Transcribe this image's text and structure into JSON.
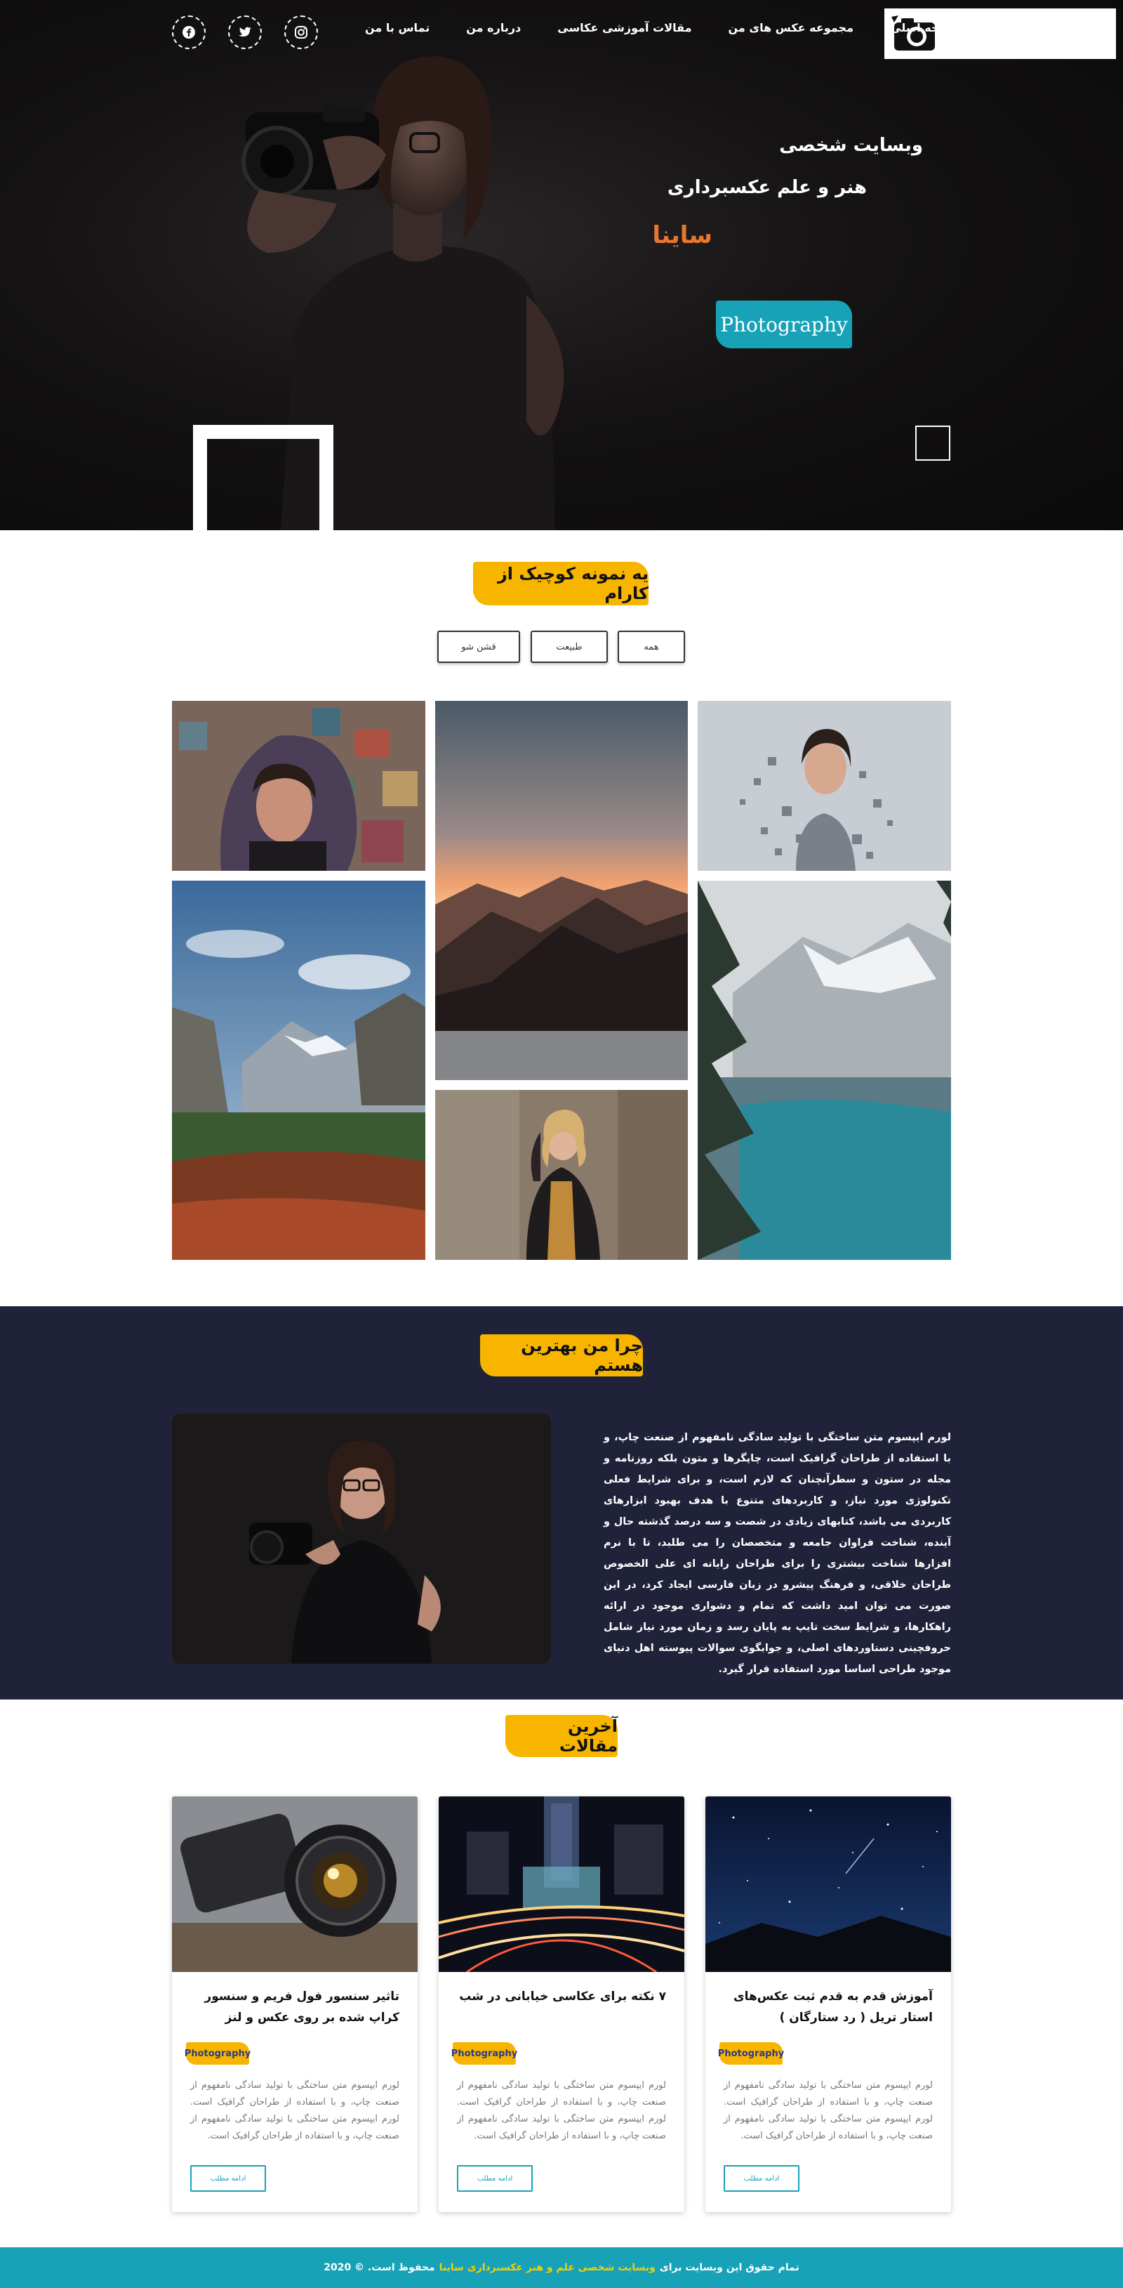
{
  "nav": {
    "items": [
      {
        "label": "صفحه اصلی"
      },
      {
        "label": "مجموعه عکس های من"
      },
      {
        "label": "مقالات آموزشی عکاسی"
      },
      {
        "label": "درباره من"
      },
      {
        "label": "تماس با من"
      }
    ],
    "socials": [
      "facebook-icon",
      "twitter-icon",
      "instagram-icon"
    ]
  },
  "hero": {
    "title": "وبسایت شخصی",
    "subtitle": "هنر و علم عکسبرداری",
    "name": "ساینا",
    "badge": "Photography"
  },
  "portfolio": {
    "heading": "یه نمونه کوچیک از کارام",
    "filters": [
      "همه",
      "طبیعت",
      "قشن شو"
    ]
  },
  "why": {
    "heading": "چرا من بهترین هستم",
    "text": "لورم ایپسوم متن ساختگی با تولید سادگی نامفهوم از صنعت چاپ، و با استفاده از طراحان گرافیک است، چاپگرها و متون بلکه روزنامه و مجله در ستون و سطرآنچنان که لازم است، و برای شرایط فعلی تکنولوژی مورد نیاز، و کاربردهای متنوع با هدف بهبود ابزارهای کاربردی می باشد، کتابهای زیادی در شصت و سه درصد گذشته حال و آینده، شناخت فراوان جامعه و متخصصان را می طلبد، تا با نرم افزارها شناخت بیشتری را برای طراحان رایانه ای علی الخصوص طراحان خلاقی، و فرهنگ پیشرو در زبان فارسی ایجاد کرد، در این صورت می توان امید داشت که تمام و دشواری موجود در ارائه راهکارها، و شرایط سخت تایپ به پایان رسد و زمان مورد نیاز شامل حروفچینی دستاوردهای اصلی، و جوابگوی سوالات پیوسته اهل دنیای موجود طراحی اساسا مورد استفاده قرار گیرد."
  },
  "articles": {
    "heading": "آخرین مقالات",
    "items": [
      {
        "title": "آموزش قدم به قدم ثبت عکس‌های استار تریل ( رد ستارگان )",
        "badge": "Photography",
        "text": "لورم ایپسوم متن ساختگی با تولید سادگی نامفهوم از صنعت چاپ، و با استفاده از طراحان گرافیک است. لورم ایپسوم متن ساختگی با تولید سادگی نامفهوم از صنعت چاپ، و با استفاده از طراحان گرافیک است.",
        "button": "ادامه مطلب"
      },
      {
        "title": "۷ نکته برای عکاسی خیابانی در شب",
        "badge": "Photography",
        "text": "لورم ایپسوم متن ساختگی با تولید سادگی نامفهوم از صنعت چاپ، و با استفاده از طراحان گرافیک است. لورم ایپسوم متن ساختگی با تولید سادگی نامفهوم از صنعت چاپ، و با استفاده از طراحان گرافیک است.",
        "button": "ادامه مطلب"
      },
      {
        "title": "تاثیر سنسور فول فریم و سنسور کراپ شده بر روی عکس و لنز",
        "badge": "Photography",
        "text": "لورم ایپسوم متن ساختگی با تولید سادگی نامفهوم از صنعت چاپ، و با استفاده از طراحان گرافیک است. لورم ایپسوم متن ساختگی با تولید سادگی نامفهوم از صنعت چاپ، و با استفاده از طراحان گرافیک است.",
        "button": "ادامه مطلب"
      }
    ]
  },
  "footer": {
    "prefix": "تمام حقوق این وبسایت برای",
    "highlight": "وبسایت شخصی علم و هنر عکسبرداری ساینا",
    "suffix": "محفوظ است. © 2020"
  },
  "colors": {
    "accent_teal": "#17a2b8",
    "accent_yellow": "#f7b500",
    "accent_orange": "#e8772e",
    "dark_section": "#20223a"
  }
}
